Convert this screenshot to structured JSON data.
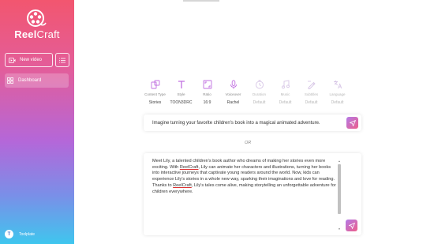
{
  "app": {
    "brand_prefix": "Reel",
    "brand_suffix": "Craft"
  },
  "sidebar": {
    "new_video_label": "New video",
    "dashboard_label": "Dashboard",
    "user_initial": "T",
    "user_name": "Toolplate"
  },
  "options": [
    {
      "icon": "content-type-icon",
      "label": "Content Type",
      "value": "Stories",
      "dim": false
    },
    {
      "icon": "style-text-icon",
      "label": "Style",
      "value": "TOON3DRC",
      "dim": false
    },
    {
      "icon": "ratio-icon",
      "label": "Ratio",
      "value": "16:9",
      "dim": false
    },
    {
      "icon": "microphone-icon",
      "label": "Voiceover",
      "value": "Rachel",
      "dim": false
    },
    {
      "icon": "duration-icon",
      "label": "Duration",
      "value": "Default",
      "dim": true
    },
    {
      "icon": "music-icon",
      "label": "Music",
      "value": "Default",
      "dim": true
    },
    {
      "icon": "subtitles-icon",
      "label": "Subtitles",
      "value": "Default",
      "dim": true
    },
    {
      "icon": "language-icon",
      "label": "Language",
      "value": "Default",
      "dim": true
    }
  ],
  "prompt": {
    "text": "Imagine turning your favorite children's book into a magical animated adventure."
  },
  "separator": "OR",
  "story": {
    "part1": "Meet Lily, a talented children's book author who dreams of making her stories even more exciting. With ",
    "link1": "ReelCraft",
    "part2": ", Lily can animate her characters and illustrations, turning her books into interactive journeys that captivate young readers around the world. Now, kids can experience Lily's stories in a whole new way, sparking their imaginations and love for reading. Thanks to ",
    "link2": "ReelCraft",
    "part3": ", Lily's tales come alive, making storytelling an unforgettable adventure for children everywhere."
  },
  "colors": {
    "accent_start": "#b37ae8",
    "accent_end": "#ee5f8a",
    "option_icon": "#c06fe0"
  }
}
